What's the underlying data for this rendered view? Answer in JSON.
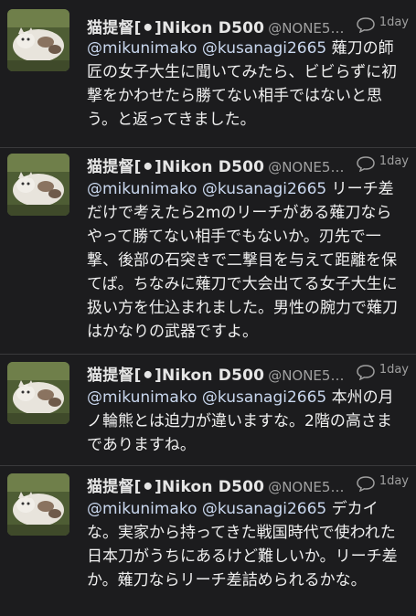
{
  "tweets": [
    {
      "name": "猫提督[⚫]Nikon D500",
      "handle": "@NONE5…",
      "time": "1day",
      "mentions": "@mikunimako @kusanagi2665",
      "text": " 薙刀の師匠の女子大生に聞いてみたら、ビビらずに初撃をかわせたら勝てない相手ではないと思う。と返ってきました。"
    },
    {
      "name": "猫提督[⚫]Nikon D500",
      "handle": "@NONE5…",
      "time": "1day",
      "mentions": "@mikunimako @kusanagi2665",
      "text": " リーチ差だけで考えたら2mのリーチがある薙刀ならやって勝てない相手でもないか。刃先で一撃、後部の石突きで二撃目を与えて距離を保てば。ちなみに薙刀で大会出てる女子大生に扱い方を仕込まれました。男性の腕力で薙刀はかなりの武器ですよ。"
    },
    {
      "name": "猫提督[⚫]Nikon D500",
      "handle": "@NONE5…",
      "time": "1day",
      "mentions": "@mikunimako @kusanagi2665",
      "text": " 本州の月ノ輪熊とは迫力が違いますな。2階の高さまでありますね。"
    },
    {
      "name": "猫提督[⚫]Nikon D500",
      "handle": "@NONE5…",
      "time": "1day",
      "mentions": "@mikunimako @kusanagi2665",
      "text": " デカイな。実家から持ってきた戦国時代で使われた日本刀がうちにあるけど難しいか。リーチ差か。薙刀ならリーチ差詰められるかな。"
    }
  ],
  "colors": {
    "background": "#1c1c1e",
    "text": "#f0f0f0",
    "secondary": "#a0a0a0",
    "divider": "#3a3a3c"
  },
  "icons": {
    "reply": "speech-bubble-icon",
    "avatar": "cat-photo-avatar"
  }
}
